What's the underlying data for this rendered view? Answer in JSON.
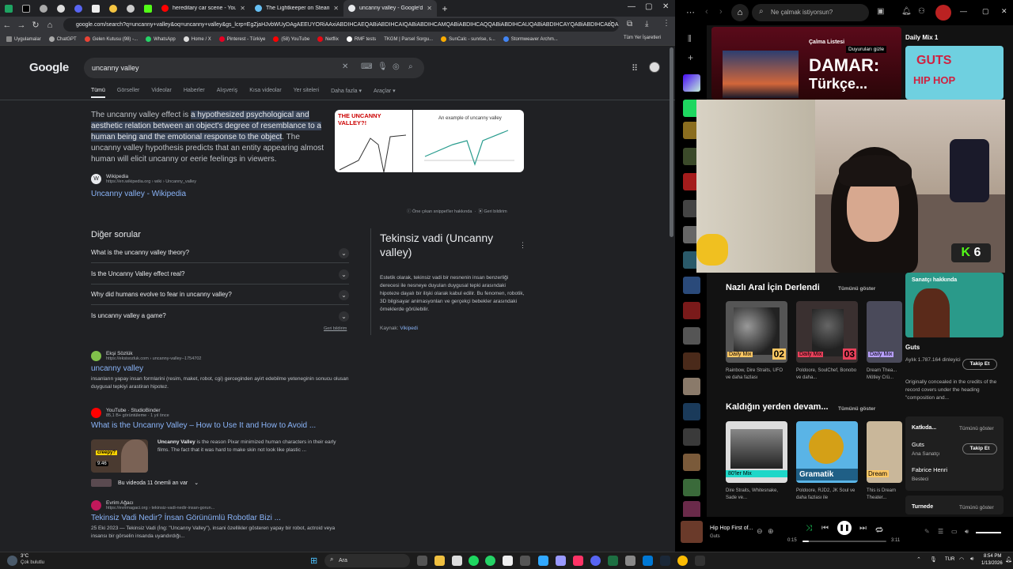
{
  "browser": {
    "tabs": [
      {
        "title": "hereditary car scene - YouTube",
        "color": "#ff0000"
      },
      {
        "title": "The Lightkeeper on Steam",
        "color": "#66c0f4"
      },
      {
        "title": "uncanny valley - Google'da Ara",
        "color": "#e8eaed"
      }
    ],
    "url": "google.com/search?q=uncanny+valley&oq=uncanny+valley&gs_lcrp=EgZjaHJvbWUyDAgAEEUYORiAAxiABDIHCAEQABiABDIHCAIQABiABDIHCAMQABiABDIHCAQQABiABDIHCAUQABiABDIHCAYQABiABDIHCAcQA...",
    "bookmarks": [
      "Uygulamalar",
      "ChatGPT",
      "Gelen Kutusu (98) -...",
      "WhatsApp",
      "Home / X",
      "Pinterest - Türkiye",
      "(58) YouTube",
      "Netflix",
      "RMF tests",
      "TKGM | Parsel Sorgu...",
      "SunCalc - sunrise, s...",
      "Stormweaver Archm..."
    ],
    "bookmarks_other": "Tüm Yer İşaretleri"
  },
  "google": {
    "logo": "Google",
    "query": "uncanny valley",
    "tabs": [
      "Tümü",
      "Görseller",
      "Videolar",
      "Haberler",
      "Alışveriş",
      "Kısa videolar",
      "Yer siteleri",
      "Daha fazla",
      "Araçlar"
    ],
    "snippet_pre": "The uncanny valley effect is ",
    "snippet_hl": "a hypothesized psychological and aesthetic relation between an object's degree of resemblance to a human being and the emotional response to the object",
    "snippet_post": ". The uncanny valley hypothesis predicts that an entity appearing almost human will elicit uncanny or eerie feelings in viewers.",
    "img1_title": "THE UNCANNY VALLEY?!",
    "img2_title": "An example of uncanny valley",
    "wiki_name": "Wikipedia",
    "wiki_url": "https://en.wikipedia.org › wiki › Uncanny_valley",
    "wiki_link": "Uncanny valley - Wikipedia",
    "featured_about": "Öne çıkan snippet'ler hakkında",
    "feedback": "Geri bildirim",
    "paa_title": "Diğer sorular",
    "paa": [
      "What is the uncanny valley theory?",
      "Is the Uncanny Valley effect real?",
      "Why did humans evolve to fear in uncanny valley?",
      "Is uncanny valley a game?"
    ],
    "paa_feedback": "Geri bildirim",
    "kp_title": "Tekinsiz vadi (Uncanny valley)",
    "kp_text": "Estetik olarak, tekinsiz vadi bir nesnenin insan benzerliği derecesi ile nesneye duyulan duygusal tepki arasındaki hipoteze dayalı bir ilişki olarak kabul edilir. Bu fenomen, robotik, 3D bilgisayar animasyonları ve gerçekçi bebekler arasındaki örneklerde görülebilir.",
    "kp_source_label": "Kaynak:",
    "kp_source": "Vikipedi",
    "results": [
      {
        "site": "Ekşi Sözlük",
        "url": "https://eksisozluk.com › uncanny-valley--1754702",
        "title": "uncanny valley",
        "desc": "insanların yapay insan formlarini (resim, maket, robot, cgi) gerceginden ayirt edebilme yeteneginin sonucu olusan duygusal tepkiyi arastiran hipotez.",
        "color": "#81c14b"
      },
      {
        "site": "YouTube · StudioBinder",
        "url": "85,1 B+ görüntüleme · 1 yıl önce",
        "title": "What is the Uncanny Valley – How to Use It and How to Avoid ...",
        "desc": "",
        "color": "#ff0000"
      },
      {
        "site": "Evrim Ağacı",
        "url": "https://evrimagaci.org › tekinsiz-vadi-nedir-insan-gorun...",
        "title": "Tekinsiz Vadi Nedir? İnsan Görünümlü Robotlar Bizi ...",
        "desc": "25 Eki 2023 — Tekinsiz Vadi (İng: \"Uncanny Valley\"), insani özellikler gösteren yapay bir robot, actroid veya insansı bir görselin insanda uyandırdığı...",
        "color": "#c2185b"
      }
    ],
    "video_desc_bold": "Uncanny Valley",
    "video_desc": " is the reason Pixar minimized human characters in their early films. The fact that it was hard to make skin not look like plastic ...",
    "video_duration": "9:46",
    "video_badge": "creepy?",
    "key_moments": "Bu videoda 11 önemli an var"
  },
  "spotify": {
    "search_placeholder": "Ne çalmak istiyorsun?",
    "hero_small": "Çalma Listesi",
    "hero_sub": "Duyuruları gizle",
    "hero_title": "DAMAR:",
    "hero_title2": "Türkçe...",
    "daily_mix_1": "Daily Mix 1",
    "section1": "Nazlı Aral İçin Derlendi",
    "section1_all": "Tümünü göster",
    "cards1": [
      {
        "badge": "Daily Mix",
        "num": "02",
        "desc": "Rainbow, Dire Straits, UFO ve daha fazlası"
      },
      {
        "badge": "Daily Mix",
        "num": "03",
        "desc": "Poldoore, SoulChef, Bonobo ve daha..."
      },
      {
        "badge": "Daily Mix",
        "num": "",
        "desc": "Dream Thea... Mötley Crü..."
      }
    ],
    "section2": "Kaldığın yerden devam...",
    "section2_all": "Tümünü göster",
    "cards2": [
      {
        "badge": "80'ler Mix",
        "desc": "Dire Straits, Whitesnake, Sade ve..."
      },
      {
        "badge": "Gramatik",
        "desc": "Poldoore, RJD2, JK Soul ve daha fazlası ile"
      },
      {
        "badge": "Dream",
        "desc": "This is Dream Theater..."
      }
    ],
    "about_artist": "Sanatçı hakkında",
    "artist": "Guts",
    "monthly": "Aylık 1.787.164 dinleyici",
    "follow": "Takip Et",
    "artist_desc": "Originally concealed in the credits of the record covers under the heading \"composition and...",
    "contributors": "Katkıda...",
    "contributors_all": "Tümünü göster",
    "contrib": [
      {
        "name": "Guts",
        "role": "Ana Sanatçı"
      },
      {
        "name": "Fabrice Henri",
        "role": "Besteci"
      }
    ],
    "tour": "Turnede",
    "tour_all": "Tümünü göster",
    "now_playing": "Hip Hop First of...",
    "now_artist": "Guts",
    "elapsed": "0:15",
    "duration": "3:11",
    "progress": 0.08,
    "cam_badge": "6",
    "guts_logo1": "GUTS",
    "guts_logo2": "HIP HOP"
  },
  "taskbar": {
    "weather_temp": "3°C",
    "weather_desc": "Çok bulutlu",
    "search": "Ara",
    "lang": "TUR",
    "time": "8:54 PM",
    "date": "1/13/2026"
  }
}
